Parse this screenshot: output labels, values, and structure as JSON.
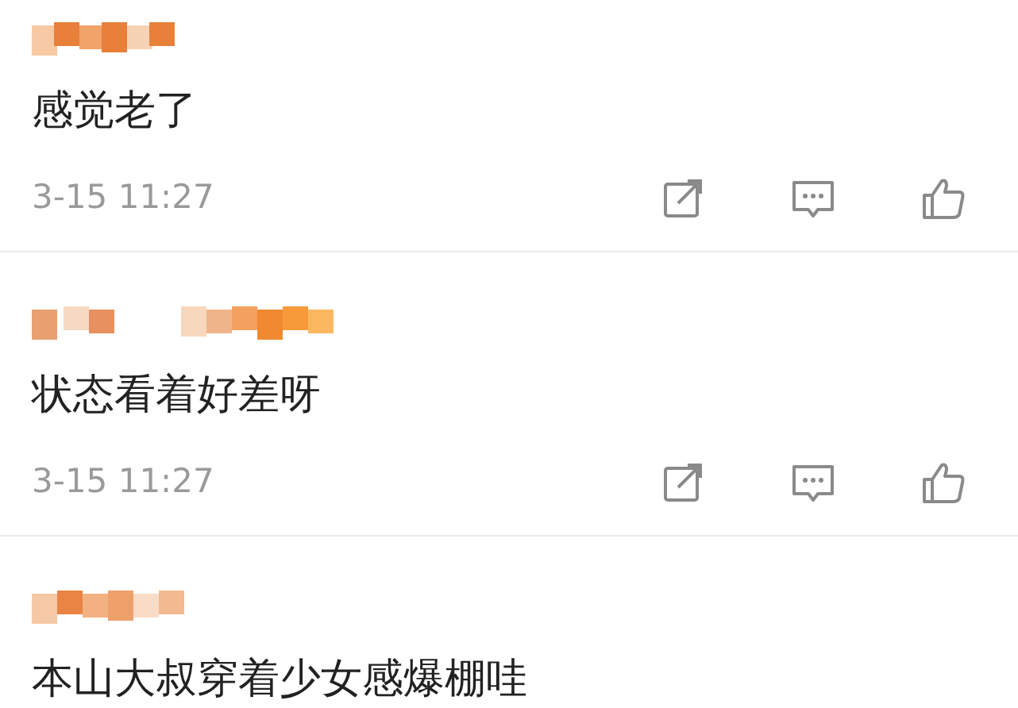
{
  "comments": [
    {
      "text": "感觉老了",
      "time": "3-15 11:27"
    },
    {
      "text": "状态看着好差呀",
      "time": "3-15 11:27"
    },
    {
      "text": "本山大叔穿着少女感爆棚哇"
    }
  ]
}
